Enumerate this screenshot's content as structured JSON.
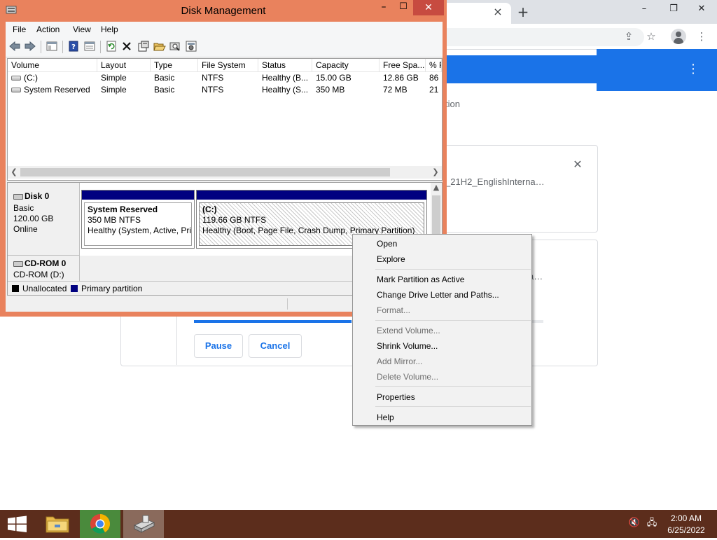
{
  "browser": {
    "tab_close": "×",
    "new_tab": "+",
    "minimize": "–",
    "restore": "❐",
    "close": "✕",
    "page": {
      "partial_text": "tion",
      "filename_partial": "_21H2_EnglishInterna…",
      "card2_partial": "a…",
      "close_glyph": "✕",
      "menu_glyph": "⋮",
      "progress_fraction": 0.45,
      "pause_button": "Pause",
      "cancel_button": "Cancel"
    }
  },
  "disk_management": {
    "title": "Disk Management",
    "window_buttons": {
      "minimize": "–",
      "maximize": "☐",
      "close": "✕"
    },
    "menu": [
      "File",
      "Action",
      "View",
      "Help"
    ],
    "columns": [
      "Volume",
      "Layout",
      "Type",
      "File System",
      "Status",
      "Capacity",
      "Free Spa...",
      "% F"
    ],
    "volumes": [
      {
        "volume": "(C:)",
        "layout": "Simple",
        "type": "Basic",
        "file_system": "NTFS",
        "status": "Healthy (B...",
        "capacity": "15.00 GB",
        "free_space": "12.86 GB",
        "pct_free": "86"
      },
      {
        "volume": "System Reserved",
        "layout": "Simple",
        "type": "Basic",
        "file_system": "NTFS",
        "status": "Healthy (S...",
        "capacity": "350 MB",
        "free_space": "72 MB",
        "pct_free": "21"
      }
    ],
    "disk0": {
      "name": "Disk 0",
      "type": "Basic",
      "size": "120.00 GB",
      "state": "Online",
      "partitions": [
        {
          "title": "System Reserved",
          "size": "350 MB NTFS",
          "status": "Healthy (System, Active, Prir"
        },
        {
          "title": "(C:)",
          "size": "119.66 GB NTFS",
          "status": "Healthy (Boot, Page File, Crash Dump, Primary Partition)"
        }
      ]
    },
    "cdrom": {
      "name": "CD-ROM 0",
      "drive": "CD-ROM (D:)"
    },
    "legend": [
      {
        "label": "Unallocated",
        "color": "#000000"
      },
      {
        "label": "Primary partition",
        "color": "#000080"
      }
    ]
  },
  "context_menu": {
    "items": [
      {
        "label": "Open",
        "enabled": true
      },
      {
        "label": "Explore",
        "enabled": true
      },
      {
        "label": "Mark Partition as Active",
        "enabled": true
      },
      {
        "label": "Change Drive Letter and Paths...",
        "enabled": true
      },
      {
        "label": "Format...",
        "enabled": false
      },
      {
        "label": "Extend Volume...",
        "enabled": false
      },
      {
        "label": "Shrink Volume...",
        "enabled": true
      },
      {
        "label": "Add Mirror...",
        "enabled": false
      },
      {
        "label": "Delete Volume...",
        "enabled": false
      },
      {
        "label": "Properties",
        "enabled": true
      },
      {
        "label": "Help",
        "enabled": true
      }
    ]
  },
  "taskbar": {
    "time": "2:00 AM",
    "date": "6/25/2022",
    "apps": [
      "start",
      "file-explorer",
      "chrome",
      "disk-management"
    ],
    "volume_icon": "speaker-muted-icon",
    "network_icon": "network-icon"
  },
  "colors": {
    "window_frame": "#e9825d",
    "close_button": "#c74b40",
    "taskbar": "#5c2d1c",
    "primary_partition": "#000080",
    "chrome_blue": "#1a73e8"
  }
}
